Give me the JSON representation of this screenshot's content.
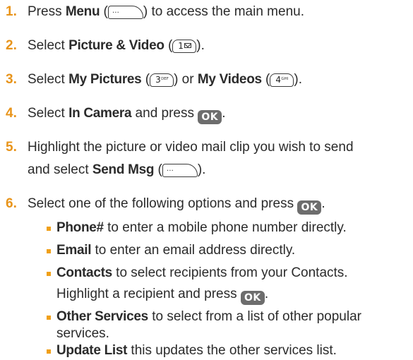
{
  "steps": [
    {
      "num": "1.",
      "pre": "Press ",
      "bold": "Menu",
      "post": " to access the main menu.",
      "paren_open": " (",
      "paren_close": ")"
    },
    {
      "num": "2.",
      "pre": "Select ",
      "bold": "Picture & Video",
      "paren_open": " (",
      "paren_close": ")."
    },
    {
      "num": "3.",
      "pre": "Select ",
      "bold": "My Pictures",
      "paren_open": " (",
      "paren_close": ")",
      "mid": " or ",
      "bold2": "My Videos",
      "paren_open2": " (",
      "paren_close2": ")."
    },
    {
      "num": "4.",
      "pre": "Select ",
      "bold": "In Camera",
      "post": " and press ",
      "end": "."
    },
    {
      "num": "5.",
      "line1": "Highlight the picture or video mail clip you wish to send",
      "pre2": "and select ",
      "bold": "Send Msg",
      "paren_open": " (",
      "paren_close": ")."
    },
    {
      "num": "6.",
      "pre": "Select one of the following options and press ",
      "end": "."
    }
  ],
  "options": [
    {
      "bold": "Phone#",
      "text": " to enter a mobile phone number directly."
    },
    {
      "bold": "Email",
      "text": " to enter an email address directly."
    },
    {
      "bold": "Contacts",
      "text": " to select recipients from your Contacts.",
      "cont_pre": "Highlight a recipient and press ",
      "cont_end": "."
    },
    {
      "bold": "Other Services",
      "text": " to select from a list of other popular",
      "cont_pre": "services."
    },
    {
      "bold": "Update List",
      "text": " this updates the other services list."
    }
  ],
  "keys": {
    "menu_glyph": "…",
    "ok": "OK",
    "one": {
      "digit": "1"
    },
    "three": {
      "digit": "3",
      "letters": "DEF"
    },
    "four": {
      "digit": "4",
      "letters": "GHI"
    }
  },
  "colors": {
    "accent": "#e8941a",
    "text": "#2b2b2b",
    "ok_key": "#6d6d6d"
  }
}
